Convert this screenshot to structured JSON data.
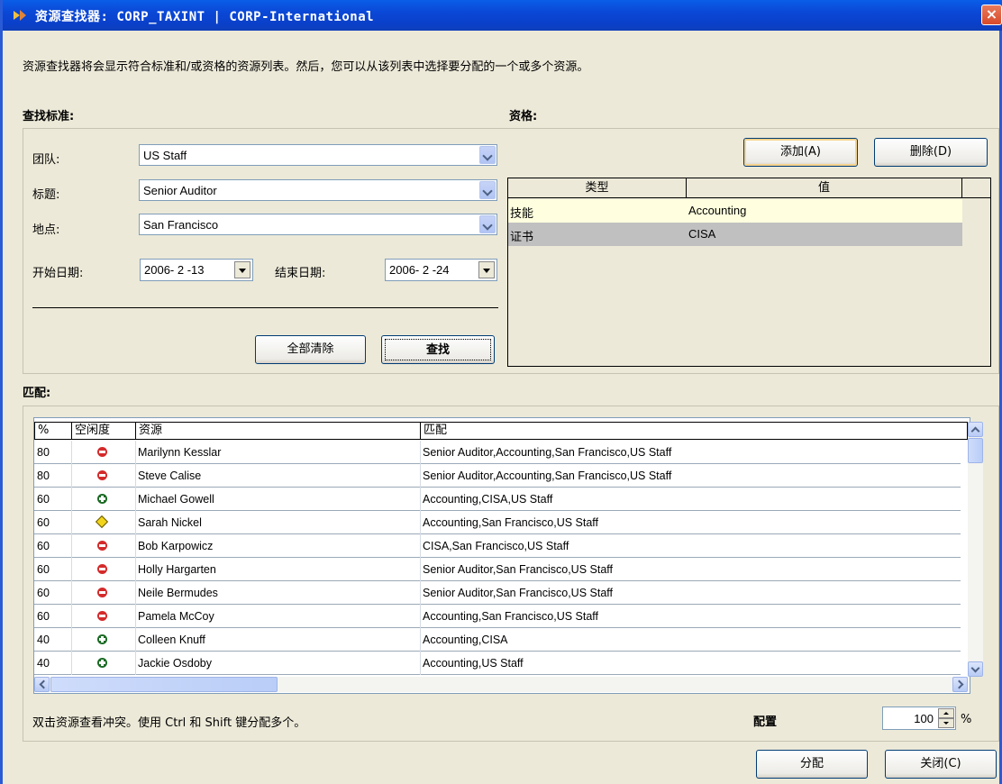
{
  "window": {
    "title": "资源查找器:   CORP_TAXINT | CORP-International",
    "close_label": "×"
  },
  "description": "资源查找器将会显示符合标准和/或资格的资源列表。然后，您可以从该列表中选择要分配的一个或多个资源。",
  "criteria": {
    "heading": "查找标准:",
    "team_label": "团队:",
    "team_value": "US Staff",
    "title_label": "标题:",
    "title_value": "Senior Auditor",
    "location_label": "地点:",
    "location_value": "San Francisco",
    "start_label": "开始日期:",
    "start_value": "2006- 2 -13",
    "end_label": "结束日期:",
    "end_value": "2006- 2 -24",
    "clear_button": "全部清除",
    "find_button": "查找"
  },
  "qualifications": {
    "heading": "资格:",
    "add_button": "添加(A)",
    "delete_button": "删除(D)",
    "columns": [
      "类型",
      "值"
    ],
    "rows": [
      {
        "type": "技能",
        "value": "Accounting"
      },
      {
        "type": "证书",
        "value": "CISA"
      }
    ]
  },
  "matches": {
    "heading": "匹配:",
    "columns": [
      "%",
      "空闲度",
      "资源",
      "匹配"
    ],
    "rows": [
      {
        "pct": "80",
        "status": "red",
        "name": "Marilynn Kesslar",
        "match": "Senior Auditor,Accounting,San Francisco,US Staff"
      },
      {
        "pct": "80",
        "status": "red",
        "name": "Steve Calise",
        "match": "Senior Auditor,Accounting,San Francisco,US Staff"
      },
      {
        "pct": "60",
        "status": "green",
        "name": "Michael Gowell",
        "match": "Accounting,CISA,US Staff"
      },
      {
        "pct": "60",
        "status": "yellow",
        "name": "Sarah Nickel",
        "match": "Accounting,San Francisco,US Staff"
      },
      {
        "pct": "60",
        "status": "red",
        "name": "Bob Karpowicz",
        "match": "CISA,San Francisco,US Staff"
      },
      {
        "pct": "60",
        "status": "red",
        "name": "Holly Hargarten",
        "match": "Senior Auditor,San Francisco,US Staff"
      },
      {
        "pct": "60",
        "status": "red",
        "name": "Neile Bermudes",
        "match": "Senior Auditor,San Francisco,US Staff"
      },
      {
        "pct": "60",
        "status": "red",
        "name": "Pamela McCoy",
        "match": "Accounting,San Francisco,US Staff"
      },
      {
        "pct": "40",
        "status": "green",
        "name": "Colleen Knuff",
        "match": "Accounting,CISA"
      },
      {
        "pct": "40",
        "status": "green",
        "name": "Jackie Osdoby",
        "match": "Accounting,US Staff"
      }
    ],
    "status_colors": {
      "red": "#d42a2a",
      "green": "#1b6a24",
      "yellow": "#f2d51a"
    }
  },
  "footer": {
    "hint": "双击资源查看冲突。使用 Ctrl 和 Shift 键分配多个。",
    "allocation_label": "配置",
    "allocation_value": "100",
    "allocation_unit": "%",
    "assign_button": "分配",
    "close_button": "关闭(C)"
  }
}
